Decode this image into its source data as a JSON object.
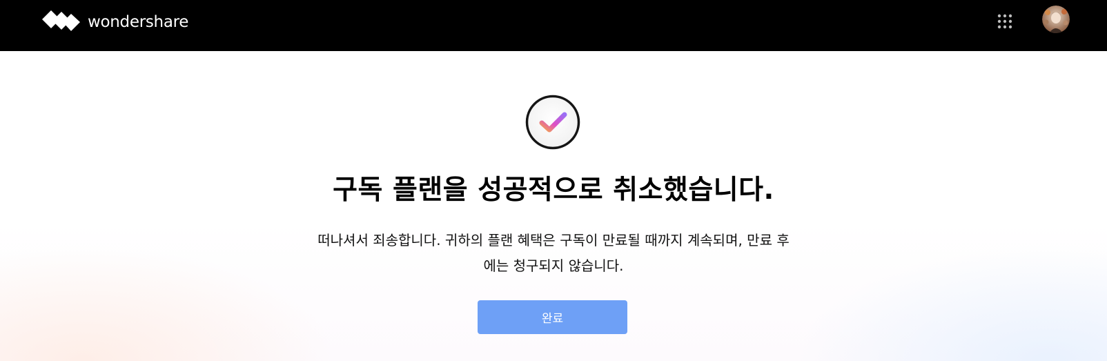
{
  "header": {
    "brand_name": "wondershare",
    "logo_icon": "wondershare-diamond-logo",
    "apps_icon": "grid-dots-icon",
    "avatar_icon": "user-avatar",
    "background_color": "#000000"
  },
  "main": {
    "status_icon": "checkmark-circle-icon",
    "title": "구독 플랜을 성공적으로 취소했습니다.",
    "message_line1": "떠나셔서 죄송합니다. 귀하의 플랜 혜택은 구독이 만료될 때까지 계속되며, 만료 후",
    "message_line2": "에는 청구되지 않습니다.",
    "done_button_label": "완료",
    "button_color": "#6ea0f6"
  }
}
